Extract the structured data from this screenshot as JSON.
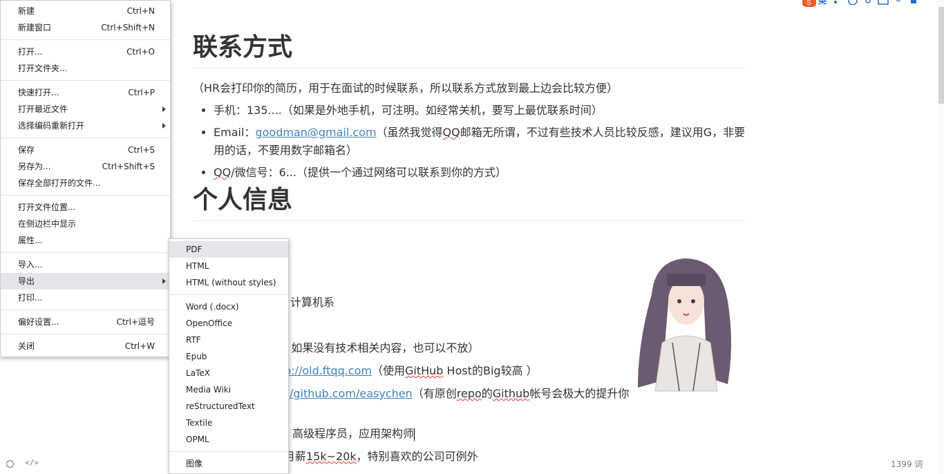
{
  "document": {
    "h_contact": "联系方式",
    "contact_intro": "（HR会打印你的简历，用于在面试的时候联系，所以联系方式放到最上边会比较方便）",
    "phone": "手机：135....（如果是外地手机，可注明。如经常关机，要写上最优联系时间）",
    "email_prefix": "Email：",
    "email_link": "goodman@gmail.com",
    "email_note_1": "（虽然我觉得",
    "email_note_qq": "QQ",
    "email_note_2": "邮箱无所谓，不过有些技术人员比较反感，建议用G，非要用的话，不要用数字邮箱名）",
    "qq_squiggle": "QQ",
    "qq_rest": "/微信号：6...（提供一个通过网络可以联系到你的方式）",
    "h_personal": "个人信息",
    "frag_cs": "计算机系",
    "frag_note": "[ 如果没有技术相关内容，也可以不放）",
    "frag_blog_link": "p://old.ftqq.com",
    "frag_blog_1": "（使用",
    "frag_blog_gh": "GitHub",
    "frag_blog_2": " Host的Big较高 ）",
    "frag_github_link": "/github.com/easychen",
    "frag_github_1": "（有原创",
    "frag_github_repo": "repo",
    "frag_github_2": "的",
    "frag_github_gh": "Github",
    "frag_github_3": "帐号会极大的提升你",
    "frag_title": "高级程序员，应用架构师",
    "frag_salary_1": "月薪",
    "frag_salary_num": "15k~20k",
    "frag_salary_2": "，特别喜欢的公司可例外"
  },
  "file_menu": {
    "new": "新建",
    "new_sc": "Ctrl+N",
    "new_window": "新建窗口",
    "new_window_sc": "Ctrl+Shift+N",
    "open": "打开...",
    "open_sc": "Ctrl+O",
    "open_folder": "打开文件夹...",
    "quick_open": "快速打开...",
    "quick_open_sc": "Ctrl+P",
    "open_recent": "打开最近文件",
    "reopen_encoding": "选择编码重新打开",
    "save": "保存",
    "save_sc": "Ctrl+S",
    "save_as": "另存为...",
    "save_as_sc": "Ctrl+Shift+S",
    "save_all": "保存全部打开的文件...",
    "open_location": "打开文件位置...",
    "show_sidebar": "在侧边栏中显示",
    "properties": "属性...",
    "import": "导入...",
    "export": "导出",
    "print": "打印...",
    "preferences": "偏好设置...",
    "preferences_sc": "Ctrl+逗号",
    "close": "关闭",
    "close_sc": "Ctrl+W"
  },
  "export_menu": {
    "pdf": "PDF",
    "html": "HTML",
    "html_no_styles": "HTML (without styles)",
    "word": "Word (.docx)",
    "openoffice": "OpenOffice",
    "rtf": "RTF",
    "epub": "Epub",
    "latex": "LaTeX",
    "mediawiki": "Media Wiki",
    "rst": "reStructuredText",
    "textile": "Textile",
    "opml": "OPML",
    "image": "图像"
  },
  "footer": {
    "source_toggle": "</>",
    "word_count": "1399 词"
  },
  "colors": {
    "link": "#4183c4",
    "menu_hover": "#e6e6ea",
    "spell_error": "#ee3333"
  }
}
